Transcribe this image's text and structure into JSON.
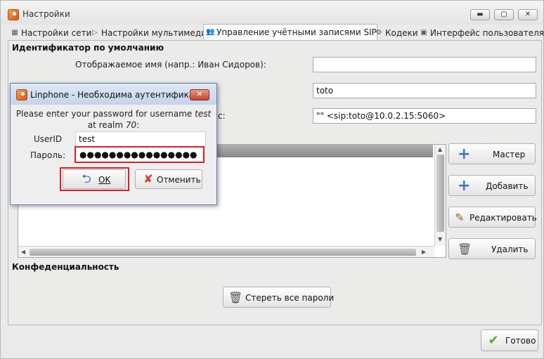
{
  "window": {
    "title": "Настройки",
    "controls": {
      "minimize": "▬",
      "maximize": "▢",
      "close": "✕"
    }
  },
  "tabs": [
    {
      "label": "Настройки сети",
      "icon": "network-icon",
      "glyph": "▦"
    },
    {
      "label": "Настройки мультимедиа",
      "icon": "play-icon",
      "glyph": "▷"
    },
    {
      "label": "Управление учётными записями SIP",
      "icon": "users-icon",
      "glyph": "👥",
      "active": true
    },
    {
      "label": "Кодеки",
      "icon": "codec-icon",
      "glyph": "⚙"
    },
    {
      "label": "Интерфейс пользователя",
      "icon": "interface-icon",
      "glyph": "▣"
    }
  ],
  "default_identity": {
    "section_title": "Идентификатор по умолчанию",
    "display_name_label": "Отображаемое имя (напр.: Иван Сидоров):",
    "display_name_value": "",
    "username_value": "toto",
    "sip_address_label_tail": "с:",
    "sip_address_value": "\"\" <sip:toto@10.0.2.15:5060>"
  },
  "account_buttons": {
    "wizard": "Мастер",
    "add": "Добавить",
    "edit": "Редактировать",
    "remove": "Удалить"
  },
  "privacy": {
    "section_title": "Конфеденциальность",
    "clear_passwords": "Стереть все пароли"
  },
  "done_button": "Готово",
  "auth_dialog": {
    "title": "Linphone - Необходима аутентификац...",
    "close_glyph": "✕",
    "message_prefix": "Please enter your password for username",
    "message_username": "test",
    "message_realm_prefix": "at realm",
    "message_realm": "70",
    "message_realm_suffix": ":",
    "userid_label": "UserID",
    "userid_value": "test",
    "password_label": "Пароль:",
    "password_value": "●●●●●●●●●●●●●●●●",
    "ok_label": "OK",
    "cancel_label": "Отменить"
  },
  "colors": {
    "highlight": "#d6202d",
    "plus_icon": "#3f77c4",
    "check_icon": "#5aa82a",
    "cancel_icon": "#d9321f"
  }
}
